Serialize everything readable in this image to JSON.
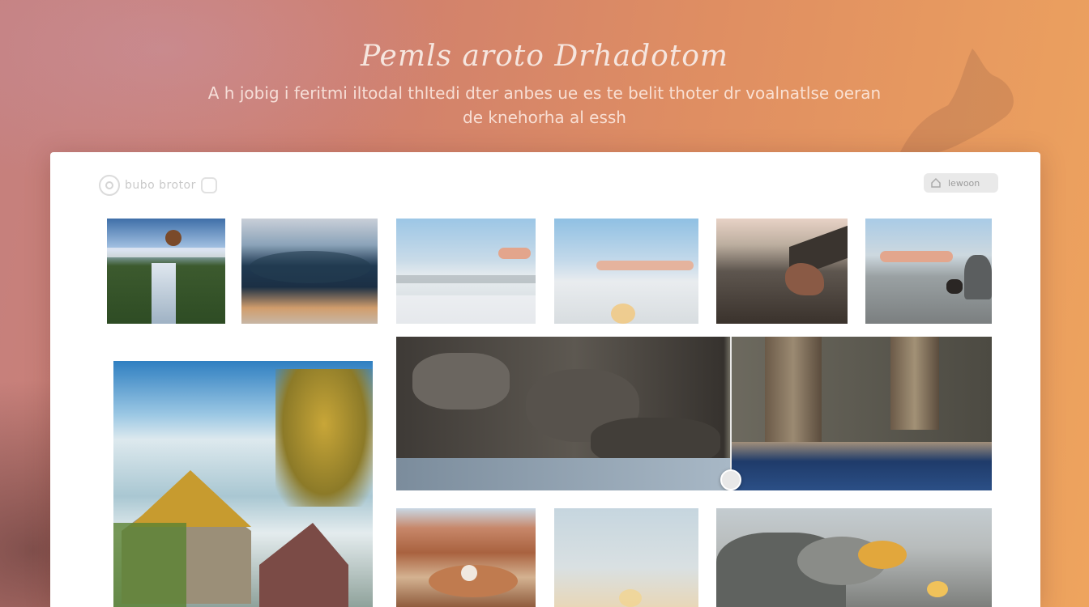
{
  "hero": {
    "title": "Pemls aroto Drhadotom",
    "subtitle": "A h jobig i feritmi iltodal thltedi dter anbes ue es te belit thoter dr voalnatlse oeran de knehorha al essh"
  },
  "toolbar": {
    "user_label": "bubo brotor",
    "right_label": "lewoon"
  },
  "icons": {
    "logo": "logo-icon",
    "user": "user-icon",
    "home": "home-icon"
  },
  "gallery": {
    "photos": [
      {
        "name": "mountain-river-photo"
      },
      {
        "name": "lake-reflection-photo"
      },
      {
        "name": "misty-shore-photo"
      },
      {
        "name": "snowy-coast-photo"
      },
      {
        "name": "twisted-tree-photo"
      },
      {
        "name": "dog-by-lake-photo"
      },
      {
        "name": "coastal-house-photo"
      },
      {
        "name": "rock-and-trees-comparison-photo"
      },
      {
        "name": "autumn-nest-photo"
      },
      {
        "name": "hazy-sky-photo"
      },
      {
        "name": "car-interior-photo"
      }
    ]
  }
}
